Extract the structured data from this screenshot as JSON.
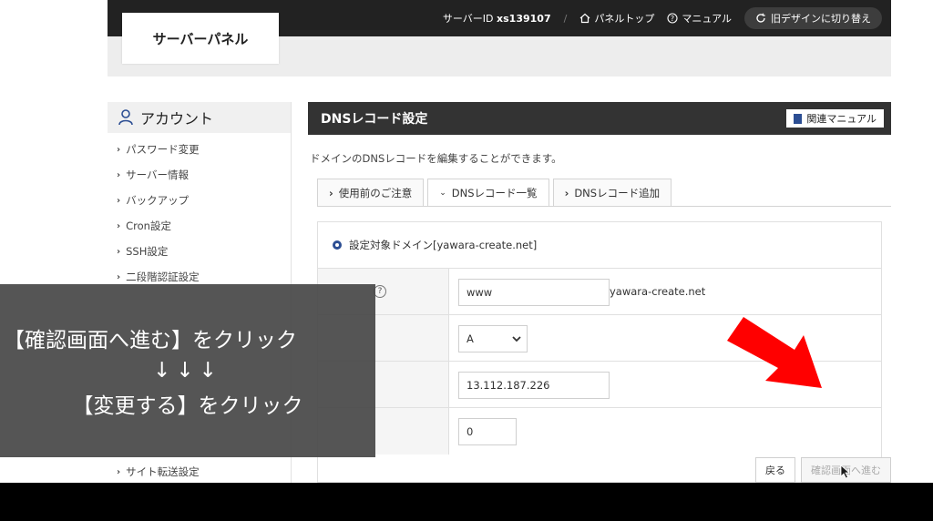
{
  "topbar": {
    "server_id_label": "サーバーID",
    "server_id": "xs139107",
    "separator": "/",
    "panel_top": "パネルトップ",
    "manual": "マニュアル",
    "old_design": "旧デザインに切り替え"
  },
  "logo": {
    "text": "サーバーパネル"
  },
  "sidebar": {
    "title": "アカウント",
    "items": [
      "パスワード変更",
      "サーバー情報",
      "バックアップ",
      "Cron設定",
      "SSH設定",
      "二段階認証設定",
      "サイト転送設定"
    ]
  },
  "main": {
    "title": "DNSレコード設定",
    "manual_button": "関連マニュアル",
    "description": "ドメインのDNSレコードを編集することができます。",
    "tabs": [
      {
        "label": "使用前のご注意"
      },
      {
        "label": "DNSレコード一覧"
      },
      {
        "label": "DNSレコード追加"
      }
    ],
    "panel_title": "設定対象ドメイン[yawara-create.net]",
    "form": {
      "host_value": "www",
      "host_suffix": "yawara-create.net",
      "type_value": "A",
      "content_value": "13.112.187.226",
      "priority_value": "0"
    },
    "buttons": {
      "back": "戻る",
      "confirm": "確認画面へ進む"
    }
  },
  "overlay": {
    "line1": "【確認画面へ進む】をクリック",
    "line2": "↓↓↓",
    "line3": "【変更する】をクリック"
  },
  "colors": {
    "topbar": "#222222",
    "accent": "#2c4e93",
    "arrow": "#ff0000"
  }
}
